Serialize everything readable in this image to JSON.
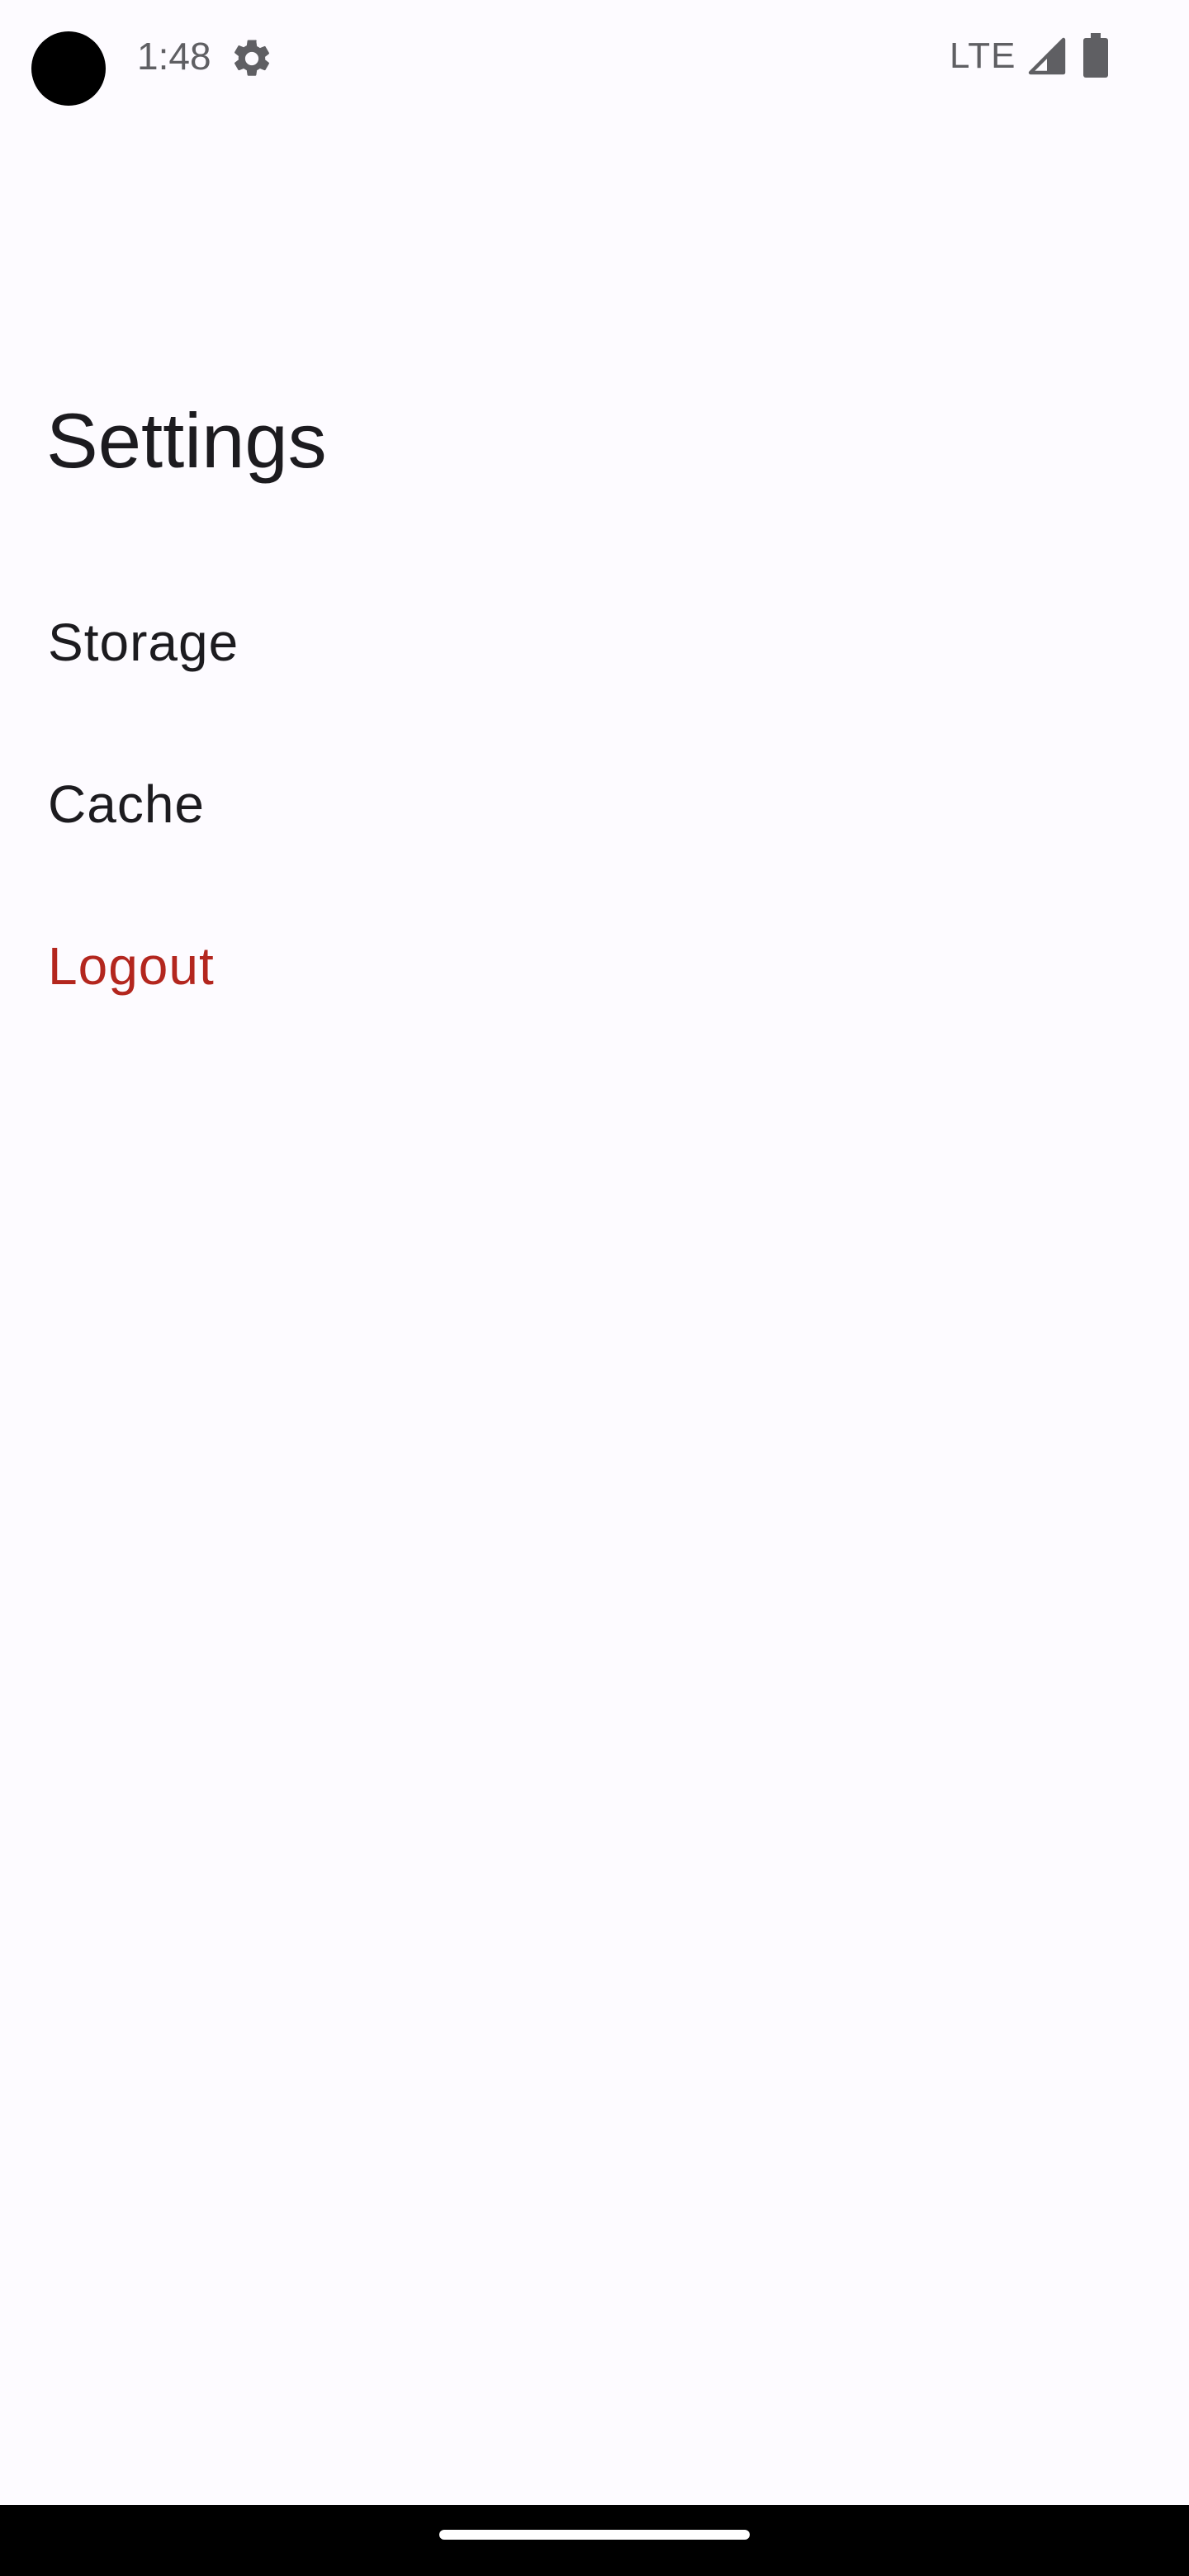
{
  "status_bar": {
    "time": "1:48",
    "network": "LTE",
    "icons": [
      "settings-icon",
      "cell-signal-icon",
      "battery-icon"
    ],
    "icon_color": "#5f5f63"
  },
  "header": {
    "title": "Settings"
  },
  "settings": {
    "items": [
      {
        "label": "Storage"
      },
      {
        "label": "Cache"
      },
      {
        "label": "Logout"
      }
    ]
  },
  "colors": {
    "background": "#fdfbff",
    "text_primary": "#1c1b1f",
    "danger": "#b3261e",
    "nav_bar": "#000000"
  }
}
